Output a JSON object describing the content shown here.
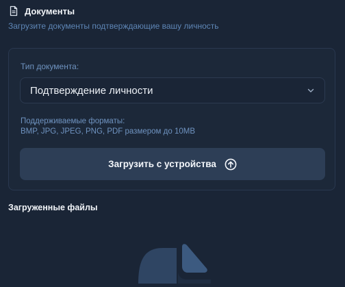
{
  "header": {
    "title": "Документы",
    "subtitle": "Загрузите документы подтверждающие вашу личность",
    "icon": "document-icon"
  },
  "form": {
    "type_label": "Тип документа:",
    "type_select": {
      "value": "Подтверждение личности",
      "icon": "chevron-down-icon"
    },
    "formats_line1": "Поддерживаемые форматы:",
    "formats_line2": "BMP, JPG, JPEG, PNG, PDF размером до 10MB",
    "upload_button": {
      "label": "Загрузить с устройства",
      "icon": "upload-circle-icon"
    }
  },
  "uploaded": {
    "title": "Загруженные файлы",
    "empty_icon": "empty-files-illustration"
  },
  "colors": {
    "background": "#1a2536",
    "card": "#1c2839",
    "button": "#2d3e56",
    "muted_text": "#6f93c0",
    "subtitle_text": "#5e86b6"
  }
}
